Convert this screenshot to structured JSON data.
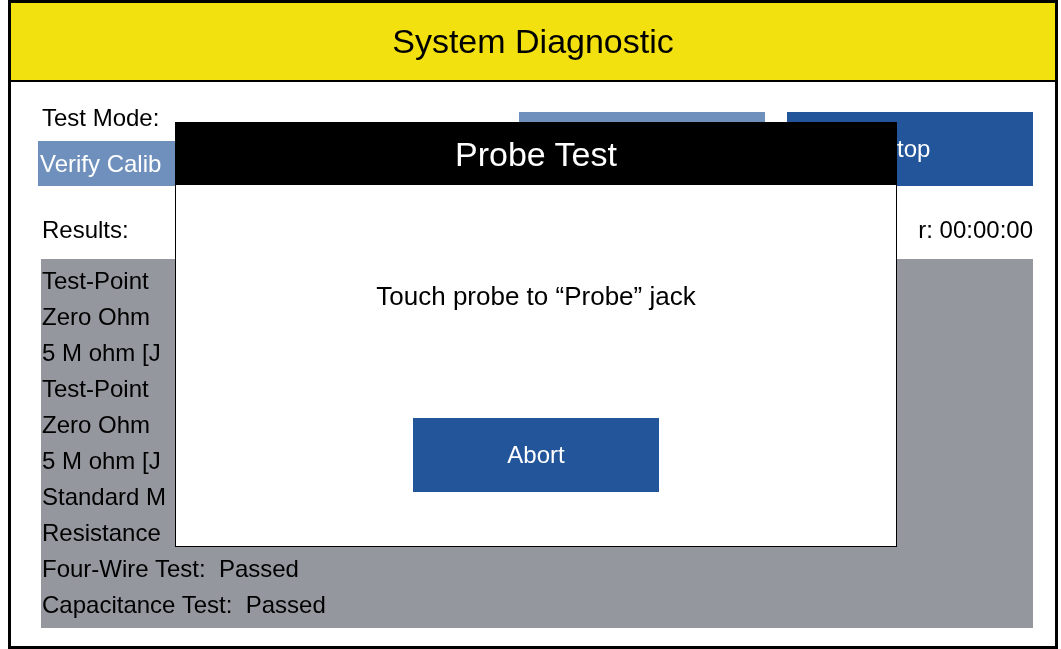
{
  "window": {
    "title": "System Diagnostic"
  },
  "test_mode": {
    "label": "Test Mode:",
    "value": "Verify Calib"
  },
  "top_buttons": [
    {
      "disabled": true
    },
    {
      "label": "top",
      "disabled": false
    }
  ],
  "results": {
    "label": "Results:",
    "timer": "r: 00:00:00",
    "lines": [
      "Test-Point",
      "Zero Ohm",
      "5 M ohm [J",
      "Test-Point",
      "Zero Ohm",
      "5 M ohm [J",
      "Standard M",
      "Resistance",
      "Four-Wire Test:  Passed",
      "Capacitance Test:  Passed"
    ]
  },
  "dialog": {
    "title": "Probe Test",
    "message": "Touch probe to “Probe” jack",
    "button": "Abort"
  }
}
